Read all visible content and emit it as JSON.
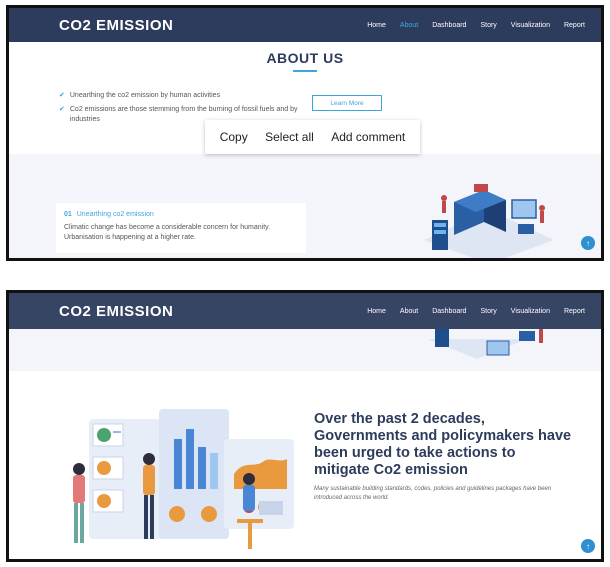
{
  "shot1": {
    "brand": "CO2 EMISSION",
    "nav": [
      "Home",
      "About",
      "Dashboard",
      "Story",
      "Visualization",
      "Report"
    ],
    "active_nav": "About",
    "about_title": "ABOUT US",
    "bullets": [
      "Unearthing the co2 emission by human activities",
      "Co2 emissions are those stemming from the burning of fossil fuels and by industries"
    ],
    "learn_more": "Learn More",
    "context_menu": [
      "Copy",
      "Select all",
      "Add comment"
    ],
    "card": {
      "number": "01",
      "title": "Unearthing co2 emission",
      "text": "Climatic change has become a considerable concern for humanity. Urbanisation is happening at a higher rate."
    }
  },
  "shot2": {
    "brand": "CO2 EMISSION",
    "nav": [
      "Home",
      "About",
      "Dashboard",
      "Story",
      "Visualization",
      "Report"
    ],
    "heading": "Over the past 2 decades, Governments and policymakers have been urged to take actions to mitigate Co2 emission",
    "subtext": "Many sustainable building standards, codes, policies and guidelines packages have been introduced across the world."
  },
  "colors": {
    "navy": "#2d3c5c",
    "accent": "#3fa6dd",
    "bg": "#f4f5fa"
  },
  "icons": {
    "fab": "arrow-up-icon",
    "bullet": "check-icon"
  }
}
